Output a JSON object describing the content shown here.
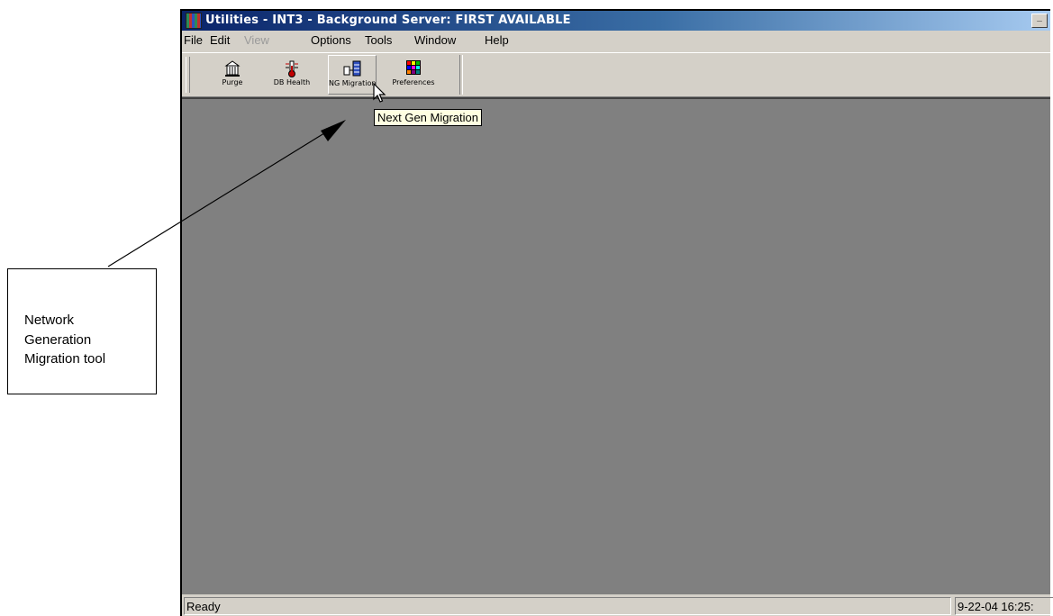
{
  "window": {
    "title": "Utilities - INT3 - Background Server: FIRST AVAILABLE",
    "minimize_symbol": "_",
    "titlebar_color": "#0a246a"
  },
  "menu": {
    "items": [
      {
        "label": "File",
        "enabled": true
      },
      {
        "label": "Edit",
        "enabled": true
      },
      {
        "label": "View",
        "enabled": false
      },
      {
        "label": "Options",
        "enabled": true
      },
      {
        "label": "Tools",
        "enabled": true
      },
      {
        "label": "Window",
        "enabled": true
      },
      {
        "label": "Help",
        "enabled": true
      }
    ]
  },
  "toolbar": {
    "buttons": [
      {
        "label": "Purge",
        "icon": "building-icon"
      },
      {
        "label": "DB Health",
        "icon": "thermometer-icon"
      },
      {
        "label": "NG Migration",
        "icon": "server-migration-icon",
        "hovered": true
      },
      {
        "label": "Preferences",
        "icon": "color-grid-icon"
      }
    ],
    "tooltip": "Next Gen Migration"
  },
  "statusbar": {
    "status": "Ready",
    "datetime": "9-22-04 16:25:"
  },
  "callout": {
    "lines": [
      "Network",
      "Generation",
      "Migration tool"
    ]
  },
  "colors": {
    "client_area": "#808080",
    "chrome": "#d4d0c8",
    "tooltip_bg": "#ffffe1"
  }
}
